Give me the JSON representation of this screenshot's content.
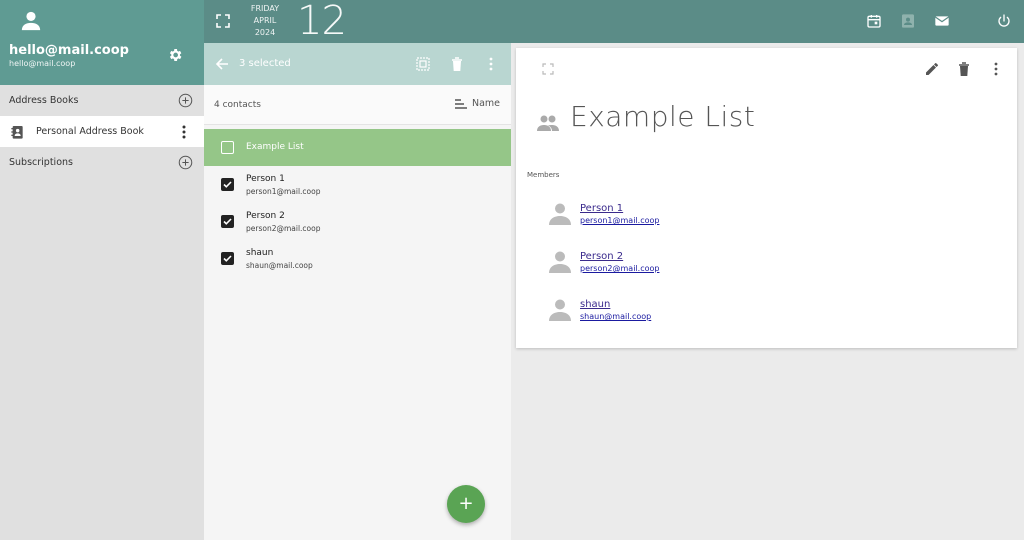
{
  "account": {
    "email_title": "hello@mail.coop",
    "email_sub": "hello@mail.coop"
  },
  "sidebar": {
    "address_books_label": "Address Books",
    "books": [
      {
        "label": "Personal Address Book"
      }
    ],
    "subscriptions_label": "Subscriptions"
  },
  "topbar": {
    "weekday": "FRIDAY",
    "month": "APRIL",
    "year": "2024",
    "day": "12"
  },
  "list": {
    "selected_text": "3 selected",
    "contact_count": "4 contacts",
    "sort_label": "Name",
    "group_row": {
      "name": "Example List",
      "checked": false
    },
    "contacts": [
      {
        "name": "Person 1",
        "email": "person1@mail.coop",
        "checked": true
      },
      {
        "name": "Person 2",
        "email": "person2@mail.coop",
        "checked": true
      },
      {
        "name": "shaun",
        "email": "shaun@mail.coop",
        "checked": true
      }
    ],
    "fab_label": "+"
  },
  "detail": {
    "title": "Example List",
    "members_label": "Members",
    "members": [
      {
        "name": "Person 1",
        "email": "person1@mail.coop"
      },
      {
        "name": "Person 2",
        "email": "person2@mail.coop"
      },
      {
        "name": "shaun",
        "email": "shaun@mail.coop"
      }
    ]
  },
  "colors": {
    "accent": "#5f9b93",
    "topbar": "#5b8c87",
    "selection_bar": "#b9d6d1",
    "group_row": "#95c688",
    "fab": "#5aa454"
  }
}
